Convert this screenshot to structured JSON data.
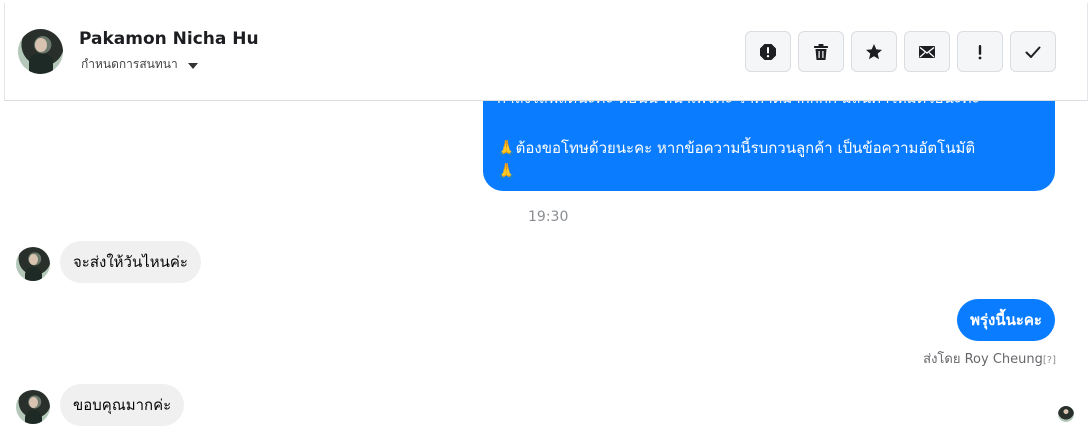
{
  "header": {
    "contact_name": "Pakamon Nicha Hu",
    "conversation_settings": "กำหนดการสนทนา",
    "actions": [
      {
        "name": "report-icon"
      },
      {
        "name": "trash-icon"
      },
      {
        "name": "star-icon"
      },
      {
        "name": "mail-icon"
      },
      {
        "name": "exclamation-icon"
      },
      {
        "name": "check-icon"
      }
    ]
  },
  "messages": {
    "outgoing_long": {
      "cut_line": "กำลังไลฟ์สดนะคะ ตอนนี้ หน้าเพจค่ะ ราคาดีมากกกก มีสินค้าใหม่ด้วยนะคะ",
      "line2": "🙏ต้องขอโทษด้วยนะคะ หากข้อความนี้รบกวนลูกค้า เป็นข้อความอัตโนมัติ",
      "line3": "🙏"
    },
    "time": "19:30",
    "incoming_1": "จะส่งให้วันไหนค่ะ",
    "outgoing_reply": "พรุ่งนี้นะคะ",
    "sent_by": "ส่งโดย Roy Cheung",
    "sent_by_help": "[?]",
    "incoming_2": "ขอบคุณมากค่ะ"
  },
  "colors": {
    "outgoing_bubble": "#0a7cff",
    "incoming_bubble": "#f0f0f0"
  }
}
